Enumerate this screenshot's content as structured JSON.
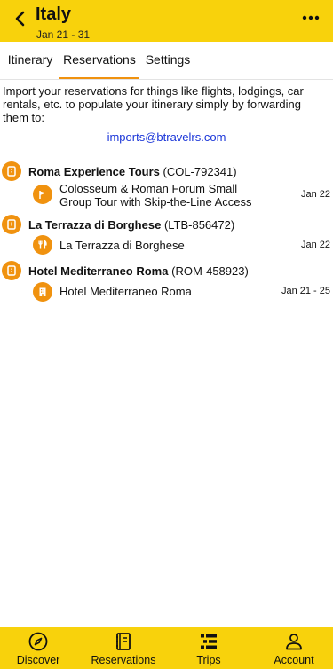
{
  "header": {
    "title": "Italy",
    "dates": "Jan 21 - 31"
  },
  "tabs": [
    {
      "label": "Itinerary",
      "active": false
    },
    {
      "label": "Reservations",
      "active": true
    },
    {
      "label": "Settings",
      "active": false
    }
  ],
  "intro": {
    "text": "Import your reservations for things like flights, lodgings, car rentals, etc. to populate your itinerary simply by forwarding them to:",
    "email": "imports@btravelrs.com"
  },
  "reservations": [
    {
      "name": "Roma Experience Tours",
      "code": "(COL-792341)",
      "icon": "ticket-icon",
      "item": {
        "icon": "flag-icon",
        "name": "Colosseum & Roman Forum Small Group Tour with Skip-the-Line Access",
        "date": "Jan 22"
      }
    },
    {
      "name": "La Terrazza di Borghese",
      "code": "(LTB-856472)",
      "icon": "ticket-icon",
      "item": {
        "icon": "fork-knife-icon",
        "name": "La Terrazza di Borghese",
        "date": "Jan 22"
      }
    },
    {
      "name": "Hotel Mediterraneo Roma",
      "code": "(ROM-458923)",
      "icon": "ticket-icon",
      "item": {
        "icon": "hotel-icon",
        "name": "Hotel Mediterraneo Roma",
        "date": "Jan 21 - 25"
      }
    }
  ],
  "bottom_nav": [
    {
      "label": "Discover",
      "icon": "compass-icon"
    },
    {
      "label": "Reservations",
      "icon": "notebook-icon"
    },
    {
      "label": "Trips",
      "icon": "list-icon"
    },
    {
      "label": "Account",
      "icon": "person-icon"
    }
  ],
  "colors": {
    "brand_yellow": "#f8d20c",
    "accent_orange": "#f0920f",
    "link_blue": "#1a35d8"
  }
}
